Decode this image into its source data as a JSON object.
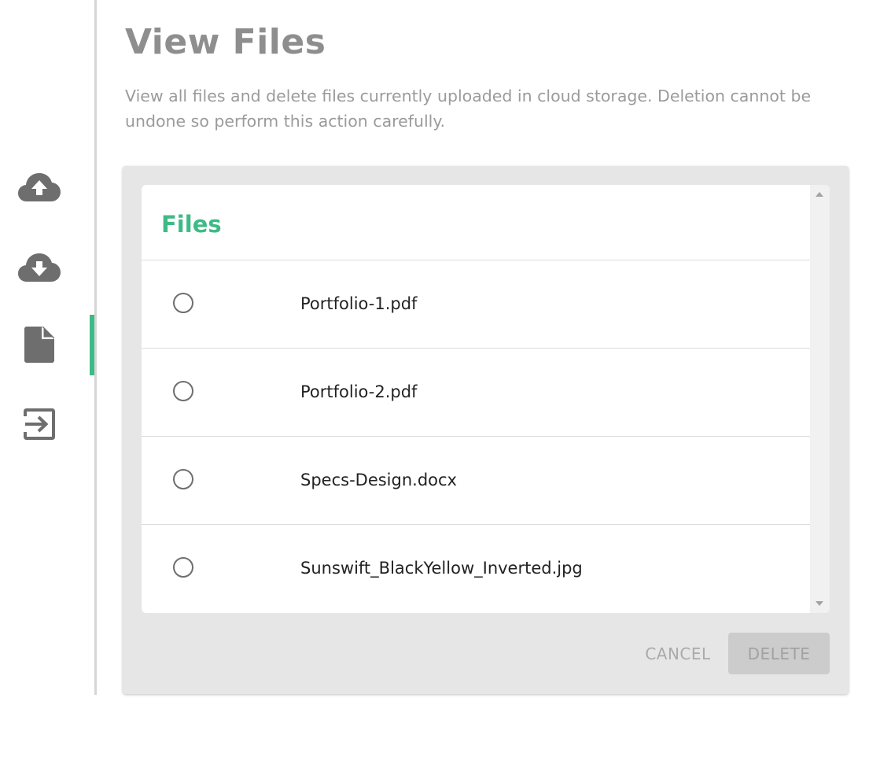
{
  "sidebar": {
    "items": [
      {
        "name": "upload",
        "icon": "cloud-upload-icon"
      },
      {
        "name": "download",
        "icon": "cloud-download-icon"
      },
      {
        "name": "files",
        "icon": "file-icon",
        "active": true
      },
      {
        "name": "logout",
        "icon": "exit-icon"
      }
    ],
    "active_color": "#3dbb86",
    "icon_color": "#6e6e6e"
  },
  "header": {
    "title": "View Files",
    "description": "View all files and delete files currently uploaded in cloud storage. Deletion cannot be undone so perform this action carefully."
  },
  "files_panel": {
    "title": "Files",
    "title_color": "#3dbb86",
    "files": [
      {
        "name": "Portfolio-1.pdf",
        "selected": false
      },
      {
        "name": "Portfolio-2.pdf",
        "selected": false
      },
      {
        "name": "Specs-Design.docx",
        "selected": false
      },
      {
        "name": "Sunswift_BlackYellow_Inverted.jpg",
        "selected": false
      }
    ]
  },
  "actions": {
    "cancel_label": "CANCEL",
    "delete_label": "DELETE"
  }
}
